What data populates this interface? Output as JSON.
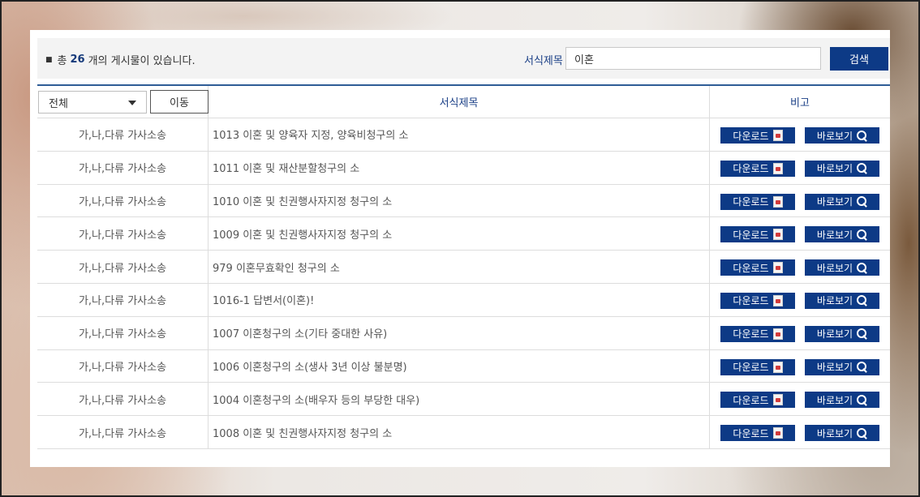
{
  "summary": {
    "prefix": "총",
    "count": "26",
    "suffix": "개의 게시물이 있습니다."
  },
  "search": {
    "label": "서식제목",
    "value": "이혼",
    "button": "검색"
  },
  "filter": {
    "selected": "전체",
    "move_button": "이동"
  },
  "columns": {
    "title": "서식제목",
    "note": "비고"
  },
  "actions": {
    "download": "다운로드",
    "view": "바로보기"
  },
  "rows": [
    {
      "category": "가,나,다류 가사소송",
      "title": "1013 이혼 및 양육자 지정, 양육비청구의 소"
    },
    {
      "category": "가,나,다류 가사소송",
      "title": "1011 이혼 및 재산분할청구의 소"
    },
    {
      "category": "가,나,다류 가사소송",
      "title": "1010 이혼 및 친권행사자지정 청구의 소"
    },
    {
      "category": "가,나,다류 가사소송",
      "title": "1009 이혼 및 친권행사자지정 청구의 소"
    },
    {
      "category": "가,나,다류 가사소송",
      "title": "979 이혼무효확인 청구의 소"
    },
    {
      "category": "가,나,다류 가사소송",
      "title": "1016-1 답변서(이혼)!"
    },
    {
      "category": "가,나,다류 가사소송",
      "title": "1007 이혼청구의 소(기타 중대한 사유)"
    },
    {
      "category": "가,나,다류 가사소송",
      "title": "1006 이혼청구의 소(생사 3년 이상 불분명)"
    },
    {
      "category": "가,나,다류 가사소송",
      "title": "1004 이혼청구의 소(배우자 등의 부당한 대우)"
    },
    {
      "category": "가,나,다류 가사소송",
      "title": "1008 이혼 및 친권행사자지정 청구의 소"
    }
  ]
}
